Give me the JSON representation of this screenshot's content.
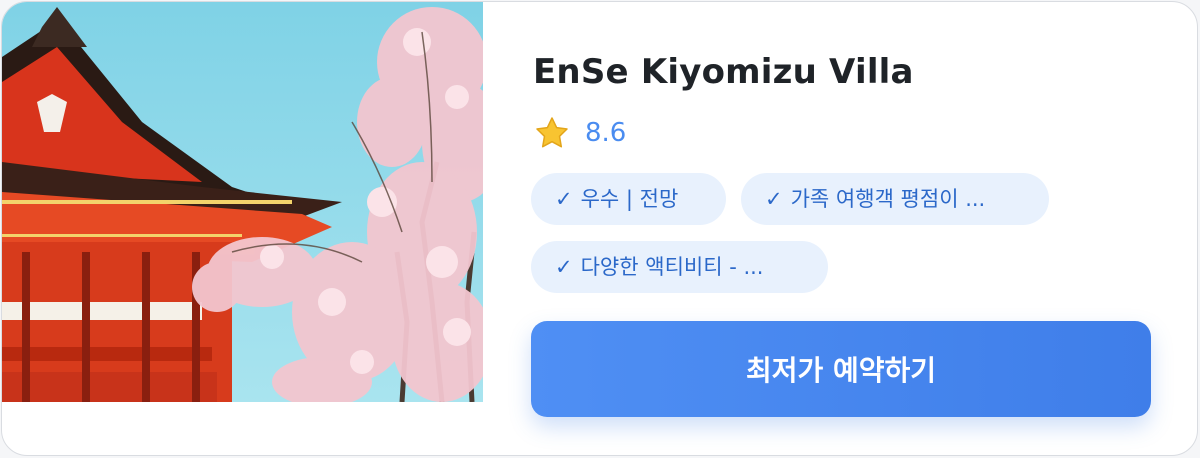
{
  "hotel": {
    "name": "EnSe Kiyomizu Villa",
    "rating": "8.6",
    "image_alt": "Kiyomizu-dera pagoda with cherry blossoms",
    "tags": [
      {
        "check": "✓",
        "label": "우수 | 전망"
      },
      {
        "check": "✓",
        "label": "가족 여행객 평점이 ..."
      },
      {
        "check": "✓",
        "label": "다양한 액티비티 - ..."
      }
    ],
    "book_label": "최저가 예약하기"
  },
  "icons": {
    "rating": "star-icon",
    "tag": "check-icon"
  },
  "colors": {
    "accent": "#4a8cf0",
    "tag_bg": "#e8f1fd",
    "tag_text": "#2b68c9",
    "button": "#4688ee",
    "title": "#1f2328"
  }
}
